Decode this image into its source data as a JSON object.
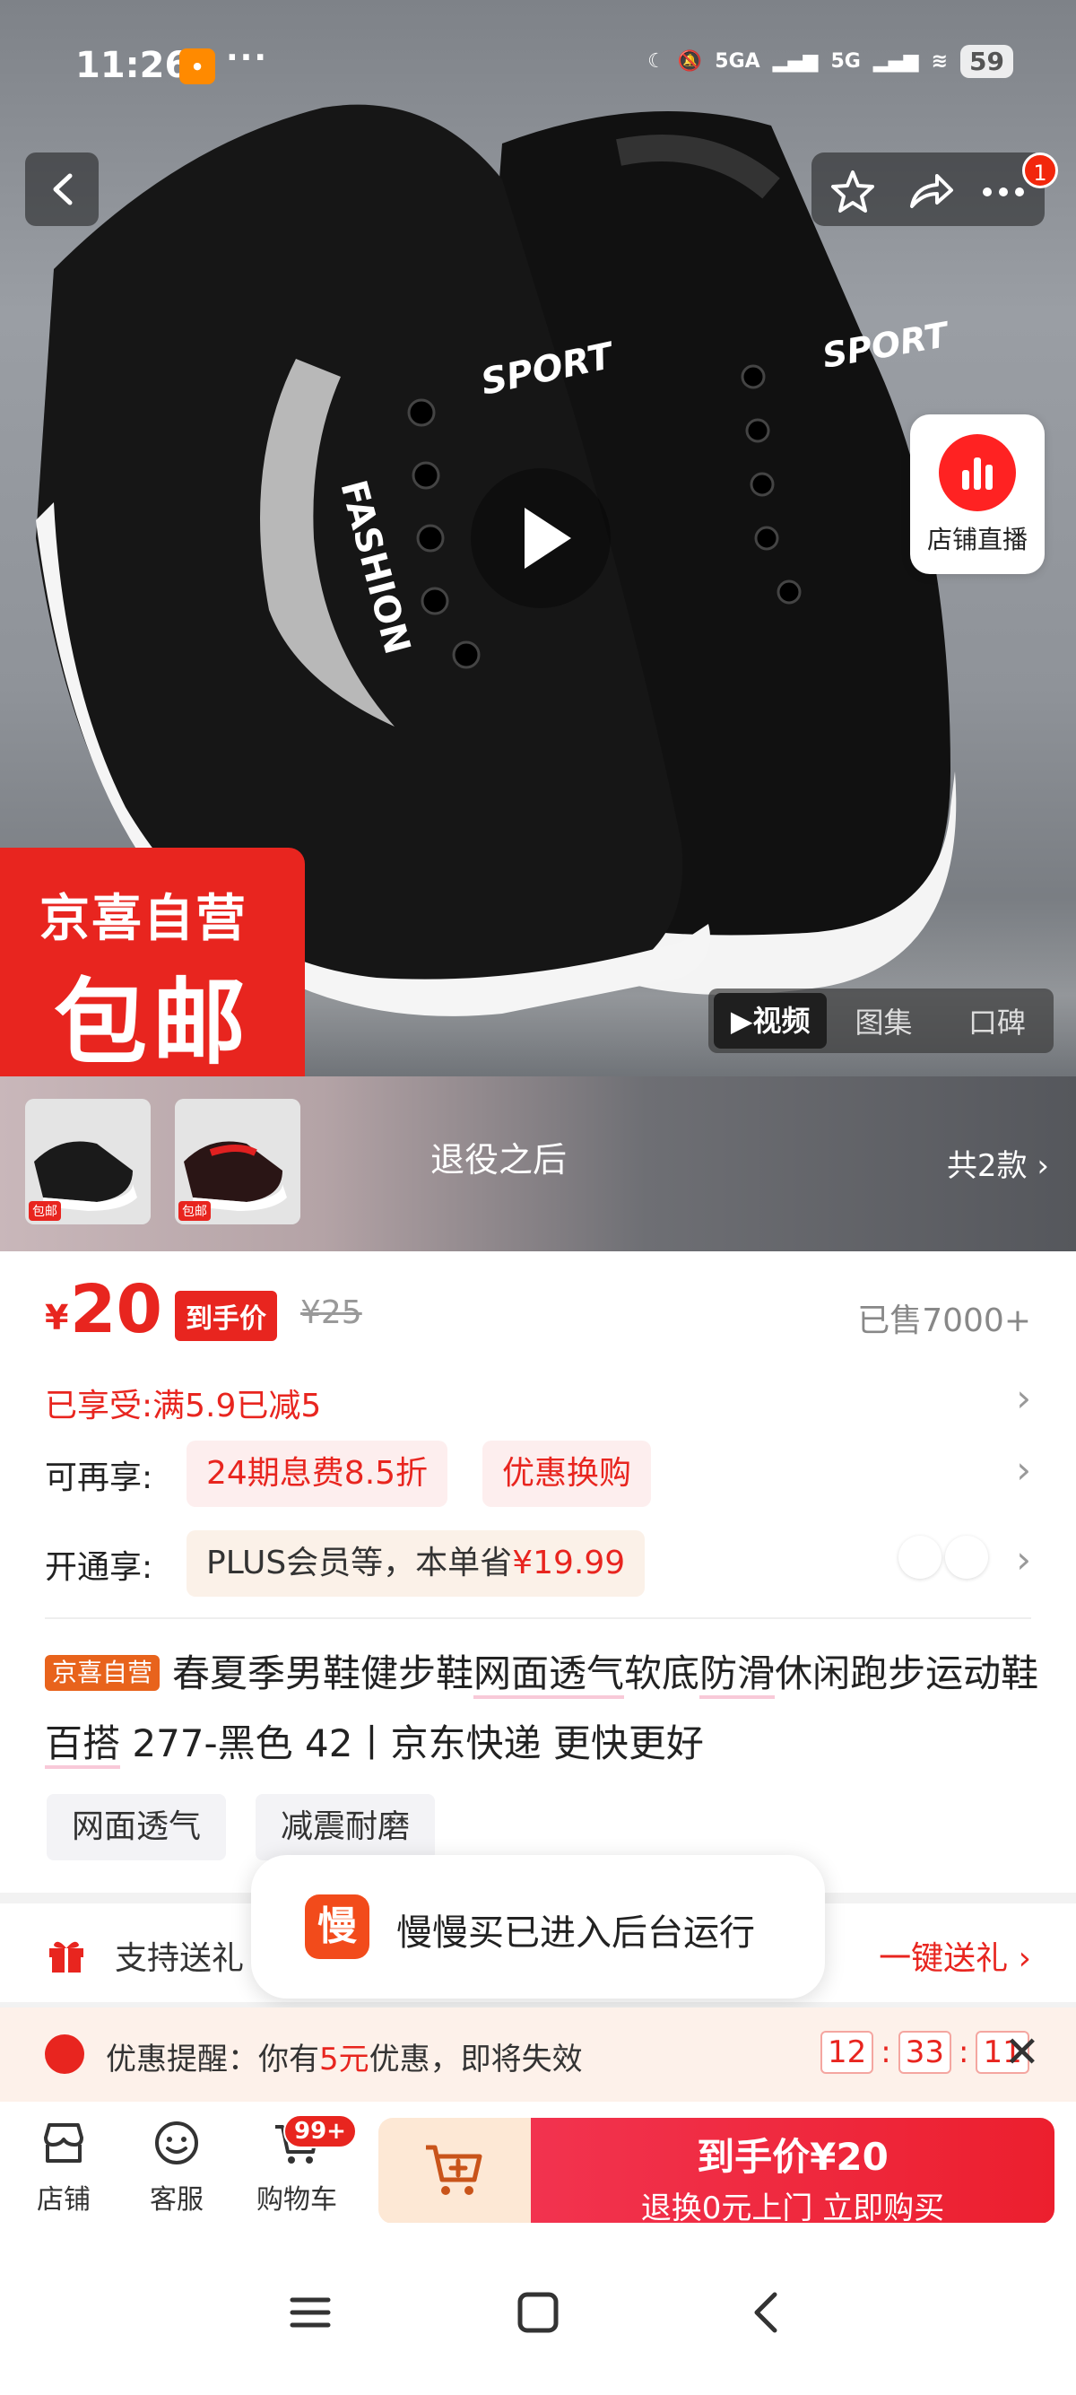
{
  "status_bar": {
    "time": "11:26",
    "signal_labels": [
      "5GA",
      "5G"
    ],
    "battery": "59"
  },
  "hero": {
    "shop_live_label": "店铺直播",
    "notification_count": "1",
    "promo_line1": "京喜自营",
    "promo_line2": "包邮",
    "shoe_texts": [
      "SPORT",
      "FASHION"
    ],
    "media_tabs": [
      {
        "label": "视频",
        "active": true
      },
      {
        "label": "图集",
        "active": false
      },
      {
        "label": "口碑",
        "active": false
      }
    ]
  },
  "variants": {
    "title": "退役之后",
    "count_label": "共2款",
    "thumb_tag": "包邮"
  },
  "price": {
    "symbol": "¥",
    "amount": "20",
    "final_tag": "到手价",
    "original": "¥25",
    "sold": "已售7000+"
  },
  "discounts": {
    "enjoyed_label": "已享受:",
    "enjoyed_value": "满5.9已减5",
    "more_label": "可再享:",
    "more_pills": [
      "24期息费8.5折",
      "优惠换购"
    ],
    "open_label": "开通享:",
    "plus_text": "PLUS会员等，本单省",
    "plus_amount": "¥19.99"
  },
  "product": {
    "store_tag": "京喜自营",
    "title_parts": [
      "春夏季男鞋健步鞋",
      "网面透气",
      "软底",
      "防滑",
      "休闲跑步运动鞋",
      "百搭",
      " 277-黑色 42丨京东快递 更快更好"
    ],
    "features": [
      "网面透气",
      "减震耐磨"
    ]
  },
  "gift": {
    "text": "支持送礼",
    "action": "一键送礼 ›"
  },
  "toast": {
    "icon_char": "慢",
    "message": "慢慢买已进入后台运行"
  },
  "reminder": {
    "text_before": "优惠提醒：你有",
    "text_amount": "5元",
    "text_after": "优惠，即将失效",
    "timer": [
      "12",
      "33",
      "11"
    ]
  },
  "bottom_bar": {
    "store": "店铺",
    "service": "客服",
    "cart": "购物车",
    "cart_badge": "99+",
    "buy_line1": "到手价¥20",
    "buy_line2": "退换0元上门 立即购买"
  },
  "colors": {
    "brand_red": "#e8251f",
    "buy_gradient": "#f2334f",
    "toast_icon": "#f24b1b"
  }
}
